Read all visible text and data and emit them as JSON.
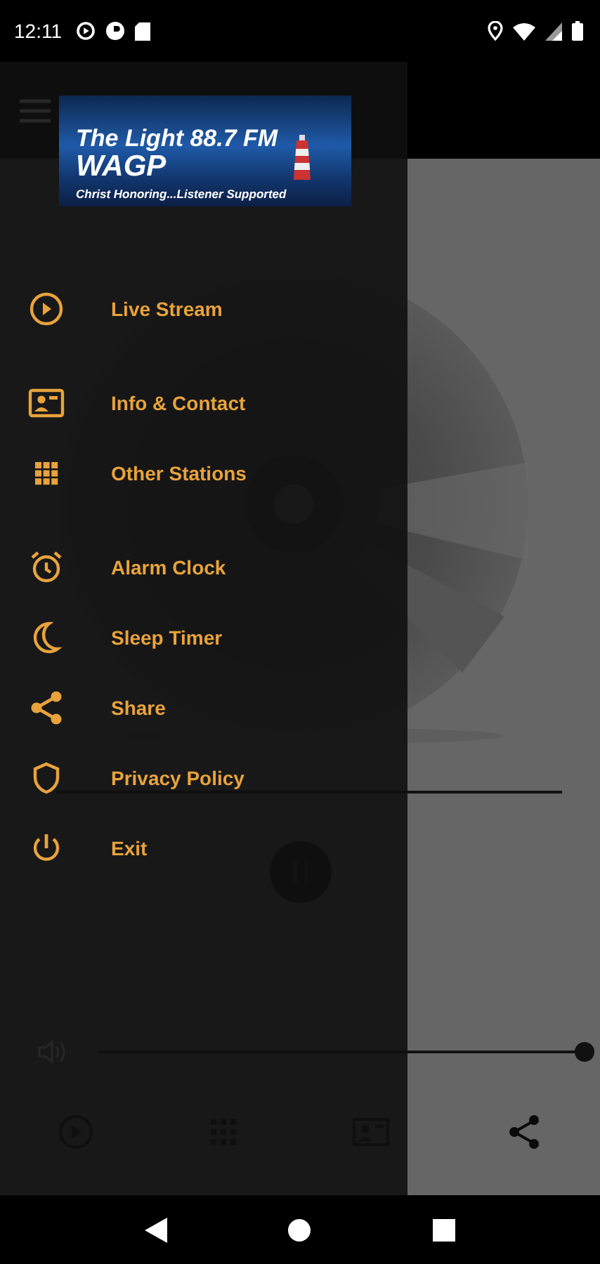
{
  "status_bar": {
    "time": "12:11"
  },
  "drawer": {
    "logo": {
      "title": "The Light 88.7 FM",
      "call_sign": "WAGP",
      "tagline": "Christ Honoring...Listener Supported"
    },
    "menu_groups": [
      [
        {
          "label": "Live Stream"
        }
      ],
      [
        {
          "label": "Info & Contact"
        },
        {
          "label": "Other Stations"
        }
      ],
      [
        {
          "label": "Alarm Clock"
        },
        {
          "label": "Sleep Timer"
        },
        {
          "label": "Share"
        },
        {
          "label": "Privacy Policy"
        },
        {
          "label": "Exit"
        }
      ]
    ]
  },
  "player": {
    "volume": {
      "level": 1.0
    }
  }
}
